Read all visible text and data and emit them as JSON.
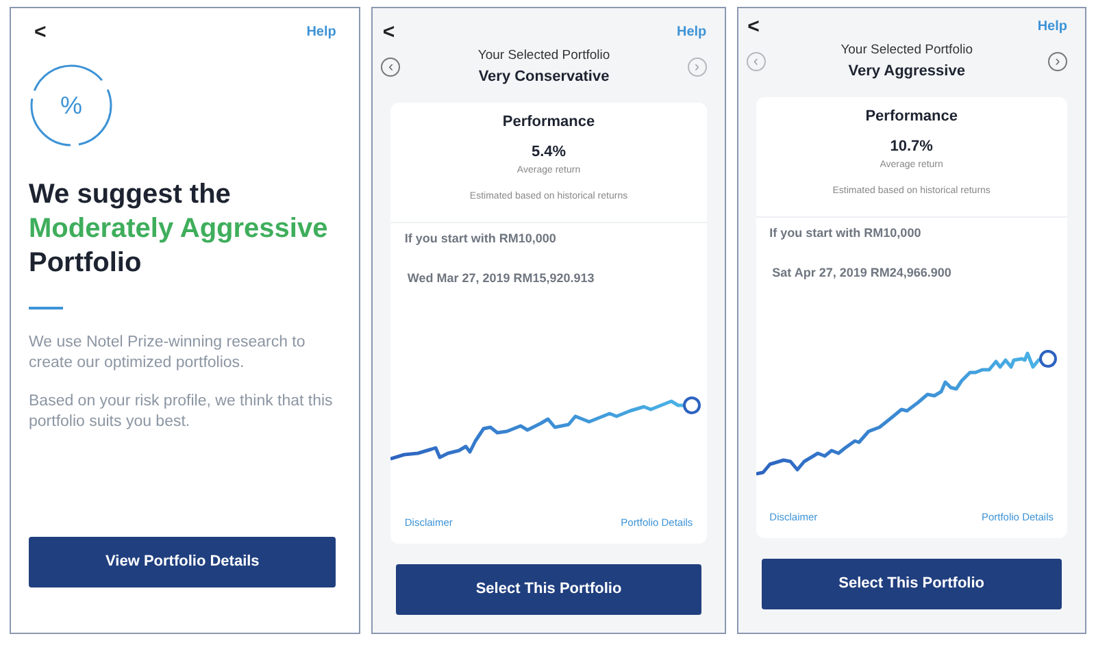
{
  "screens": [
    {
      "kind": "suggestion",
      "back": "<",
      "help": "Help",
      "badge": "%",
      "heading": [
        {
          "text": "We suggest the",
          "highlight": false
        },
        {
          "text": "Moderately Aggressive",
          "highlight": true
        },
        {
          "text": "Portfolio",
          "highlight": false
        }
      ],
      "paragraphs": [
        "We use Notel Prize-winning research to create our optimized portfolios.",
        "Based on your risk profile, we think that this portfolio suits you best."
      ],
      "button": "View Portfolio Details"
    },
    {
      "kind": "portfolio",
      "back": "<",
      "help": "Help",
      "prev": {
        "label": "‹",
        "disabled": false
      },
      "next": {
        "label": "›",
        "disabled": true
      },
      "subtitle": "Your Selected Portfolio",
      "name": "Very Conservative",
      "performance": {
        "title": "Performance",
        "value": "5.4%",
        "caption": "Average return",
        "note": "Estimated based on historical returns"
      },
      "start": "If you start with RM10,000",
      "reading": "Wed Mar 27, 2019 RM15,920.913",
      "links": [
        "Disclaimer",
        "Portfolio Details"
      ],
      "button": "Select This Portfolio"
    },
    {
      "kind": "portfolio",
      "back": "<",
      "help": "Help",
      "prev": {
        "label": "‹",
        "disabled": true
      },
      "next": {
        "label": "›",
        "disabled": false
      },
      "subtitle": "Your Selected Portfolio",
      "name": "Very Aggressive",
      "performance": {
        "title": "Performance",
        "value": "10.7%",
        "caption": "Average return",
        "note": "Estimated based on historical returns"
      },
      "start": "If you start with RM10,000",
      "reading": "Sat Apr 27, 2019 RM24,966.900",
      "links": [
        "Disclaimer",
        "Portfolio Details"
      ],
      "button": "Select This Portfolio"
    }
  ]
}
